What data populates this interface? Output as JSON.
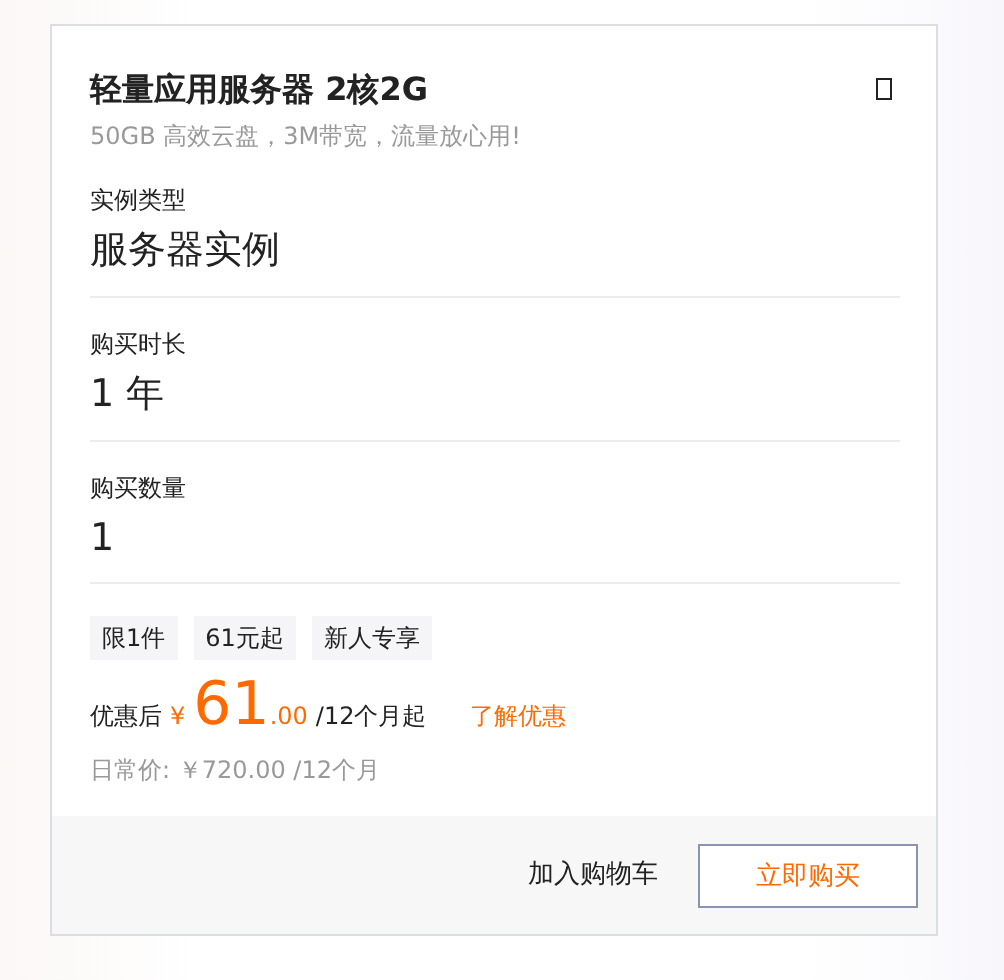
{
  "product": {
    "title": "轻量应用服务器 2核2G",
    "subtitle": "50GB 高效云盘，3M带宽，流量放心用!"
  },
  "fields": [
    {
      "label": "实例类型",
      "value": "服务器实例"
    },
    {
      "label": "购买时长",
      "value": "1 年"
    },
    {
      "label": "购买数量",
      "value": "1"
    }
  ],
  "tags": [
    "限1件",
    "61元起",
    "新人专享"
  ],
  "price": {
    "prefix": "优惠后",
    "currency": "¥",
    "integer": "61",
    "decimal": ".00",
    "suffix": "/12个月起",
    "link": "了解优惠",
    "regular": "日常价: ￥720.00 /12个月"
  },
  "buttons": {
    "cart": "加入购物车",
    "buy": "立即购买"
  }
}
